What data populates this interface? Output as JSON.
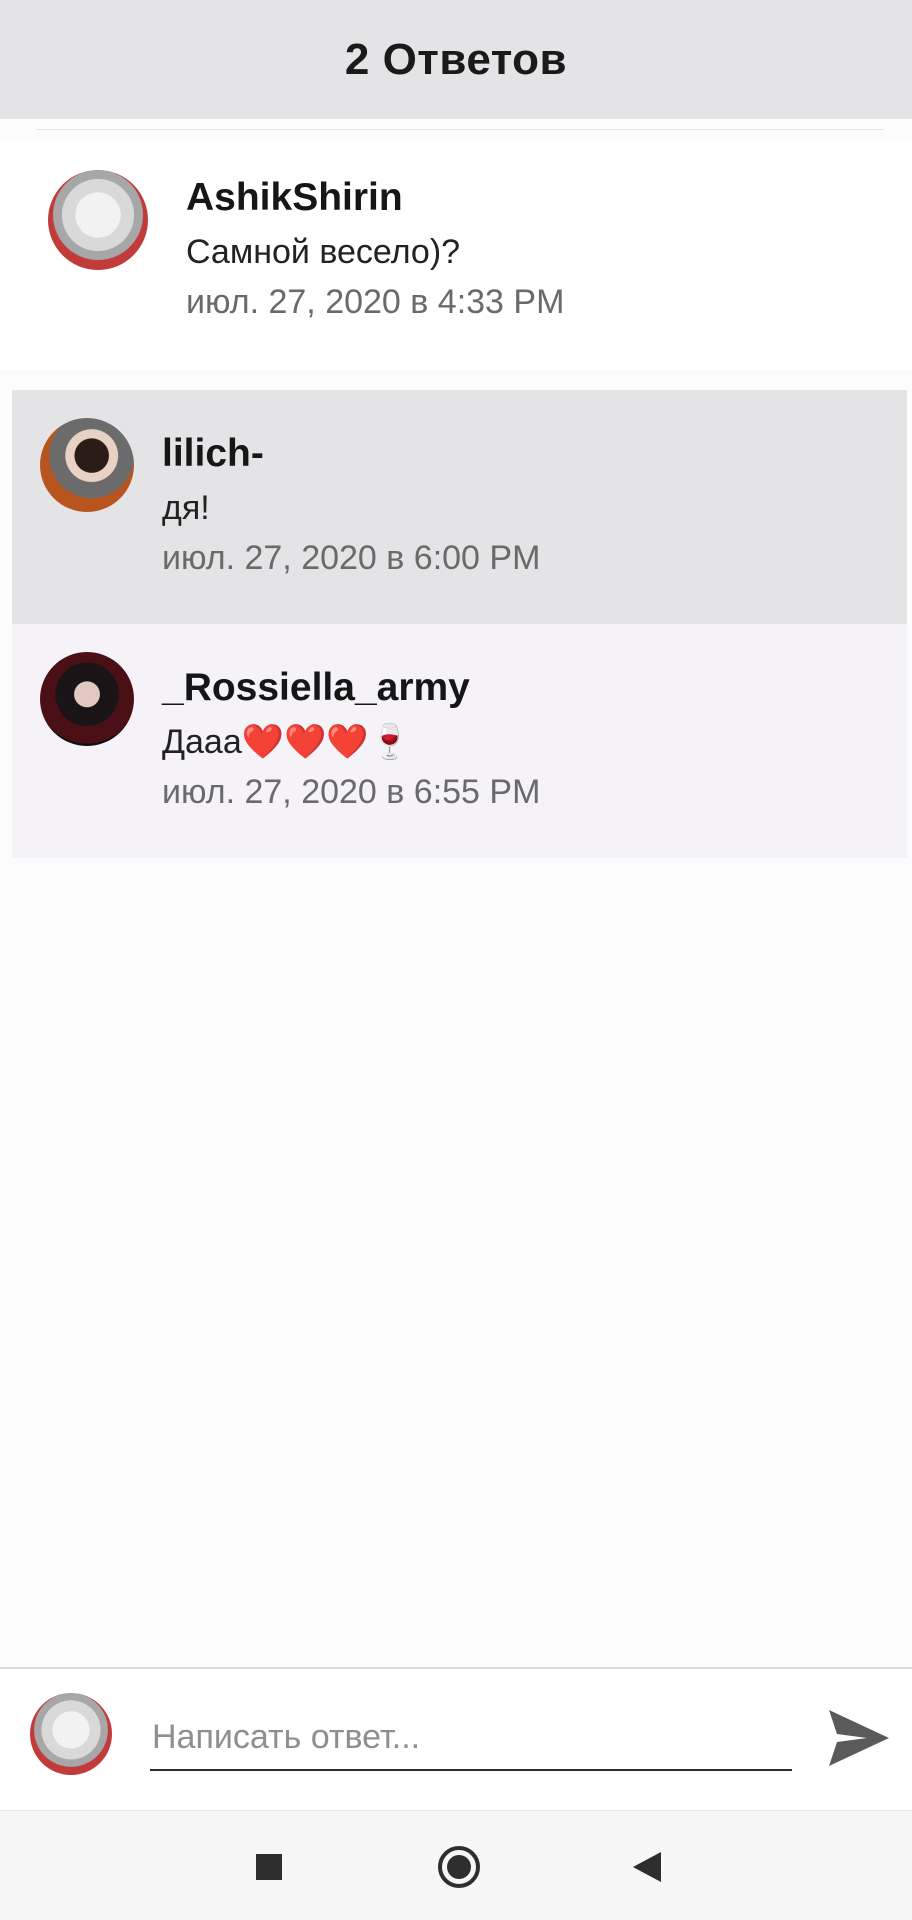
{
  "header": {
    "title": "2 Ответов"
  },
  "comments": [
    {
      "username": "AshikShirin",
      "text": "Самной весело)?",
      "time": "июл. 27, 2020 в 4:33 PM",
      "avatar": "anime-avatar"
    },
    {
      "username": "lilich-",
      "text": "дя!",
      "time": "июл. 27, 2020 в 6:00 PM",
      "avatar": "photo-avatar"
    },
    {
      "username": "_Rossiella_army",
      "text": "Дааа❤️❤️❤️🍷",
      "time": "июл. 27, 2020 в 6:55 PM",
      "avatar": "photo-avatar"
    }
  ],
  "composer": {
    "placeholder": "Написать ответ...",
    "value": "",
    "send_icon": "send-icon"
  },
  "navbar": {
    "icons": [
      "recents-icon",
      "home-icon",
      "back-icon"
    ]
  },
  "colors": {
    "header_bg": "#e4e3e5",
    "highlight_bg": "#e4e3e5",
    "alt_row_bg": "#f5f3f7",
    "text_primary": "#161616",
    "text_secondary": "#6a6a6a"
  }
}
